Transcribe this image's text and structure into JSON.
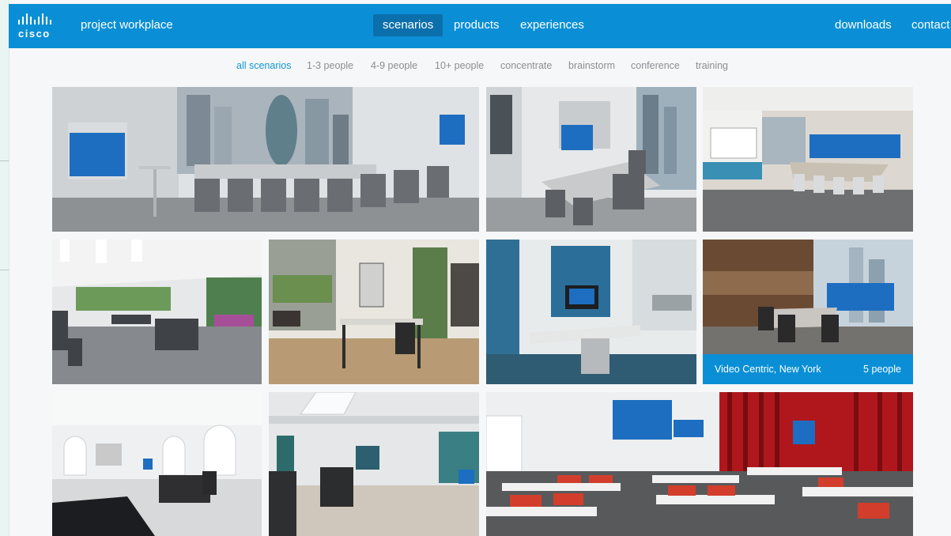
{
  "header": {
    "logo_text": "cisco",
    "brand": "project workplace",
    "nav": [
      {
        "label": "scenarios",
        "active": true
      },
      {
        "label": "products"
      },
      {
        "label": "experiences"
      }
    ],
    "right_links": [
      {
        "label": "downloads"
      },
      {
        "label": "contact"
      }
    ],
    "accent_color": "#0a8fd6"
  },
  "filters": {
    "items": [
      {
        "label": "all scenarios",
        "active": true
      },
      {
        "label": "1-3 people"
      },
      {
        "label": "4-9 people"
      },
      {
        "label": "10+ people"
      },
      {
        "label": "concentrate"
      },
      {
        "label": "brainstorm"
      },
      {
        "label": "conference"
      },
      {
        "label": "training"
      }
    ],
    "active_color": "#1496d8"
  },
  "gallery": {
    "tiles": [
      {
        "scene": "large boardroom with city view"
      },
      {
        "scene": "meeting room with corner windows"
      },
      {
        "scene": "conference room with video wall"
      },
      {
        "scene": "open plan office with benches"
      },
      {
        "scene": "home office desk"
      },
      {
        "scene": "small focus room"
      },
      {
        "scene": "video centric room",
        "caption": {
          "name": "Video Centric, New York",
          "people": "5 people"
        }
      },
      {
        "scene": "executive office with arched windows"
      },
      {
        "scene": "atrium with skylight"
      },
      {
        "scene": "training room with red chairs"
      }
    ]
  }
}
